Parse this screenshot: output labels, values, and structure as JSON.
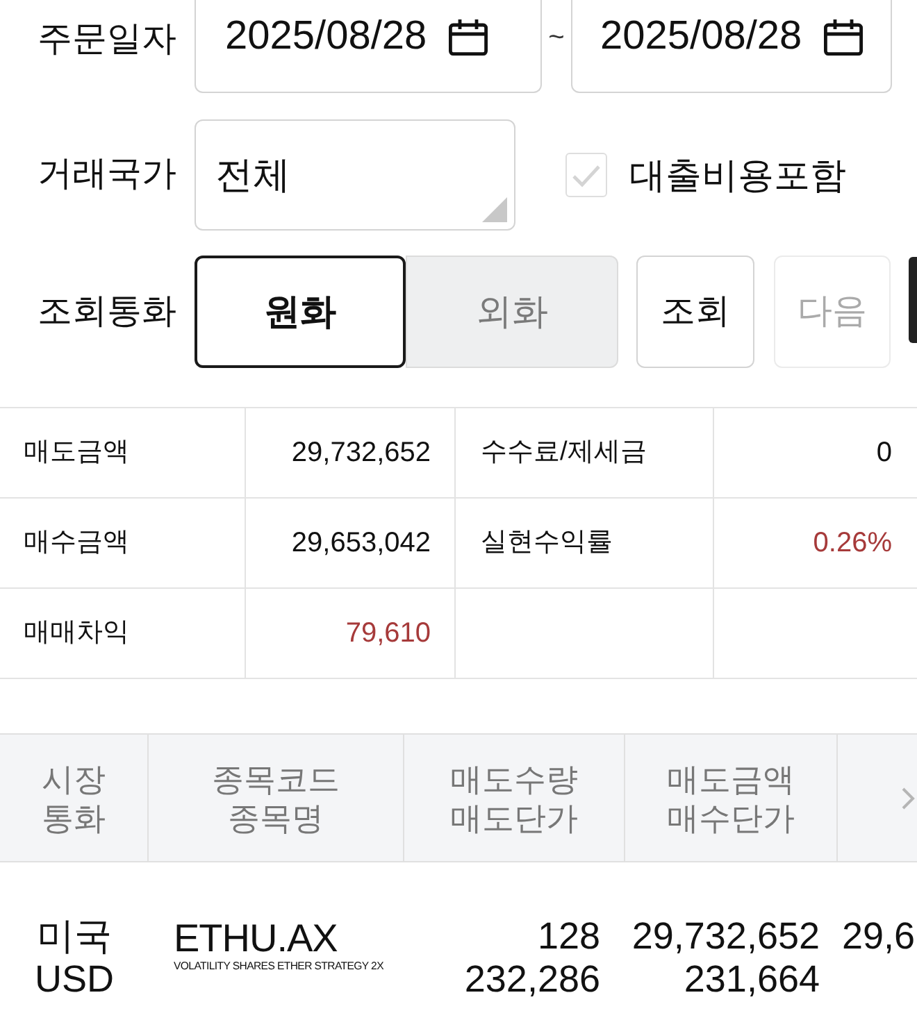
{
  "filters": {
    "order_date": {
      "label": "주문일자",
      "from": "2025/08/28",
      "separator": "~",
      "to": "2025/08/28"
    },
    "country": {
      "label": "거래국가",
      "value": "전체"
    },
    "loan_cost": {
      "label": "대출비용포함",
      "checked": false
    },
    "currency": {
      "label": "조회통화",
      "options": [
        {
          "label": "원화",
          "selected": true
        },
        {
          "label": "외화",
          "selected": false
        }
      ]
    },
    "buttons": [
      {
        "label": "조회",
        "disabled": false
      },
      {
        "label": "다음",
        "disabled": true
      }
    ]
  },
  "summary": {
    "rows": [
      [
        {
          "label": "매도금액",
          "value": "29,732,652",
          "positive": false
        },
        {
          "label": "수수료/제세금",
          "value": "0",
          "positive": false
        }
      ],
      [
        {
          "label": "매수금액",
          "value": "29,653,042",
          "positive": false
        },
        {
          "label": "실현수익률",
          "value": "0.26%",
          "positive": true
        }
      ],
      [
        {
          "label": "매매차익",
          "value": "79,610",
          "positive": true
        }
      ]
    ]
  },
  "table": {
    "columns": [
      {
        "label": "시장\n통화"
      },
      {
        "label": "종목코드\n종목명"
      },
      {
        "label": "매도수량\n매도단가"
      },
      {
        "label": "매도금액\n매수단가"
      }
    ],
    "rows": [
      {
        "market": "미국",
        "currency": "USD",
        "code": "ETHU.AX",
        "name": "VOLATILITY SHARES ETHER STRATEGY 2X",
        "sell_quantity": "128",
        "sell_price": "232,286",
        "sell_amount": "29,732,652",
        "buy_price": "231,664",
        "column_5": "29,6"
      }
    ]
  }
}
